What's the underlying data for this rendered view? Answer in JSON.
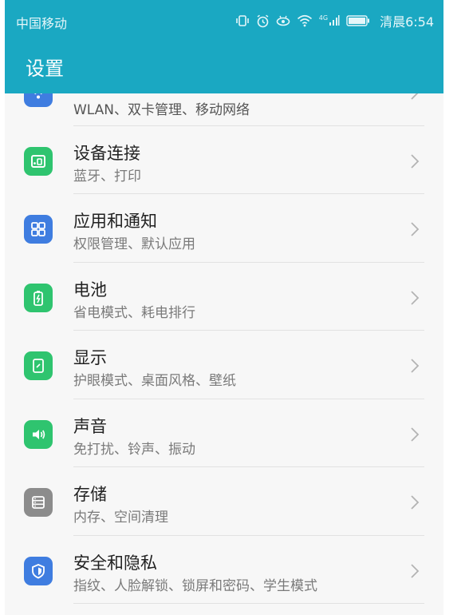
{
  "status": {
    "carrier": "中国移动",
    "network_label": "4G",
    "time": "清晨6:54"
  },
  "header": {
    "title": "设置"
  },
  "items": [
    {
      "subtitle": "WLAN、双卡管理、移动网络",
      "icon": "wifi-icon",
      "color": "#3f7de0"
    },
    {
      "title": "设备连接",
      "subtitle": "蓝牙、打印",
      "icon": "device-connect-icon",
      "color": "#2fc46f"
    },
    {
      "title": "应用和通知",
      "subtitle": "权限管理、默认应用",
      "icon": "apps-icon",
      "color": "#3f7de0"
    },
    {
      "title": "电池",
      "subtitle": "省电模式、耗电排行",
      "icon": "battery-icon",
      "color": "#2fc46f"
    },
    {
      "title": "显示",
      "subtitle": "护眼模式、桌面风格、壁纸",
      "icon": "display-icon",
      "color": "#2fc46f"
    },
    {
      "title": "声音",
      "subtitle": "免打扰、铃声、振动",
      "icon": "speaker-icon",
      "color": "#2fc46f"
    },
    {
      "title": "存储",
      "subtitle": "内存、空间清理",
      "icon": "storage-icon",
      "color": "#8c8c8c"
    },
    {
      "title": "安全和隐私",
      "subtitle": "指纹、人脸解锁、锁屏和密码、学生模式",
      "icon": "shield-icon",
      "color": "#3f7de0"
    }
  ]
}
